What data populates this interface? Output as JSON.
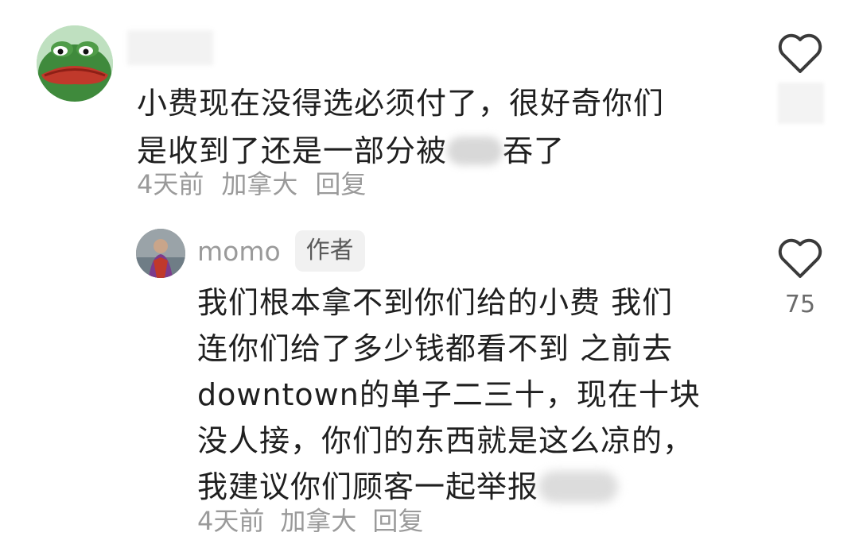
{
  "top_comment": {
    "text_line1": "小费现在没得选必须付了，很好奇你们",
    "text_line2a": "是收到了还是一部分被",
    "text_line2b": "吞了",
    "time": "4天前",
    "location": "加拿大",
    "reply_label": "回复"
  },
  "reply": {
    "username": "momo",
    "badge": "作者",
    "lines": [
      "我们根本拿不到你们给的小费 我们",
      "连你们给了多少钱都看不到 之前去",
      "downtown的单子二三十，现在十块",
      "没人接，你们的东西就是这么凉的，"
    ],
    "last_line": "我建议你们顾客一起举报",
    "time": "4天前",
    "location": "加拿大",
    "reply_label": "回复",
    "like_count": "75"
  },
  "icons": {
    "like": "heart-outline-icon"
  },
  "colors": {
    "text": "#1f1f1f",
    "meta": "#9a9a9a",
    "badge_bg": "#f1f1f1"
  }
}
